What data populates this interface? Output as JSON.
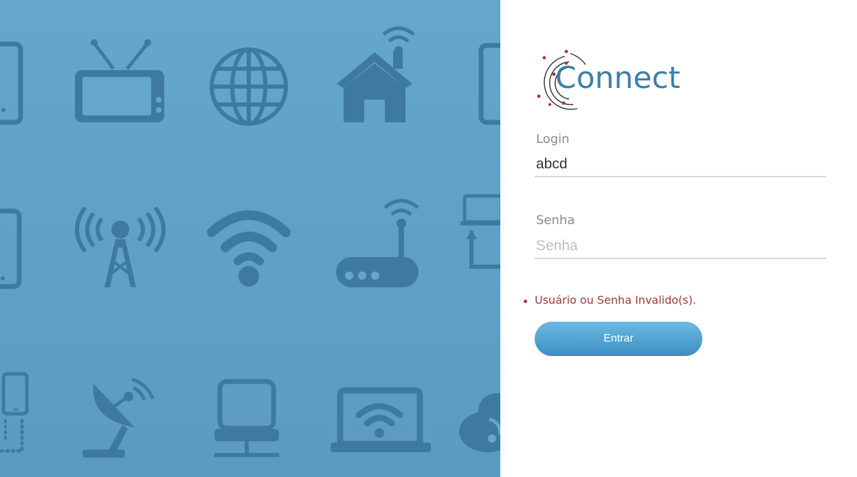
{
  "brand": {
    "name": "Connect",
    "primary_color": "#3a7fa8",
    "accent_color": "#a83232",
    "panel_color": "#64a6cc",
    "icon_color": "#3e7aa0"
  },
  "background_icons": [
    "smartphone-icon",
    "tv-icon",
    "globe-icon",
    "smart-home-icon",
    "tablet-icon",
    "smartphone-icon",
    "radio-tower-icon",
    "wifi-icon",
    "router-icon",
    "laptop-sync-icon",
    "phone-network-icon",
    "satellite-dish-icon",
    "desktop-computer-icon",
    "laptop-wifi-icon",
    "cloud-icon"
  ],
  "login_form": {
    "login_label": "Login",
    "login_value": "abcd",
    "password_label": "Senha",
    "password_placeholder": "Senha",
    "password_value": "",
    "errors": [
      "Usuário ou Senha Invalido(s)."
    ],
    "submit_label": "Entrar"
  }
}
